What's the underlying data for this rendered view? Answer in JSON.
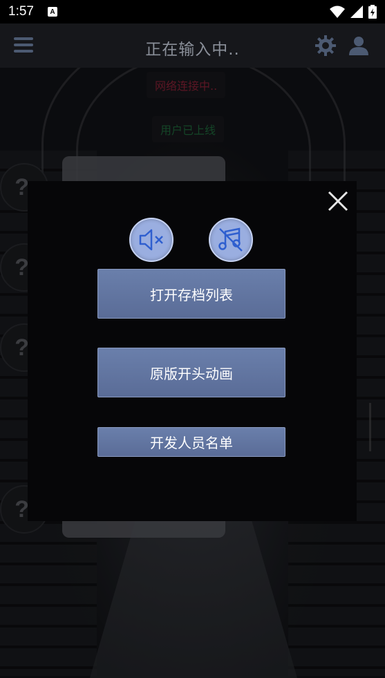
{
  "status_bar": {
    "time": "1:57",
    "notification_icon": "A"
  },
  "app_bar": {
    "title": "正在输入中.."
  },
  "background": {
    "network_status": "网络连接中..",
    "user_status": "用户已上线",
    "side_icon_glyph": "?"
  },
  "dialog": {
    "buttons": {
      "archive_list": "打开存档列表",
      "original_opening": "原版开头动画",
      "credits": "开发人员名单"
    }
  },
  "colors": {
    "button_blue": "#6175a2",
    "round_button": "#9aaee0",
    "network_red": "#8d2238",
    "online_green": "#1f6a3d",
    "icon_blue": "#2f5fcf"
  },
  "icons": {
    "menu": "hamburger-icon",
    "settings": "gear-icon",
    "profile": "user-icon",
    "close": "close-icon",
    "mute": "volume-mute-icon",
    "music_off": "music-off-icon"
  }
}
